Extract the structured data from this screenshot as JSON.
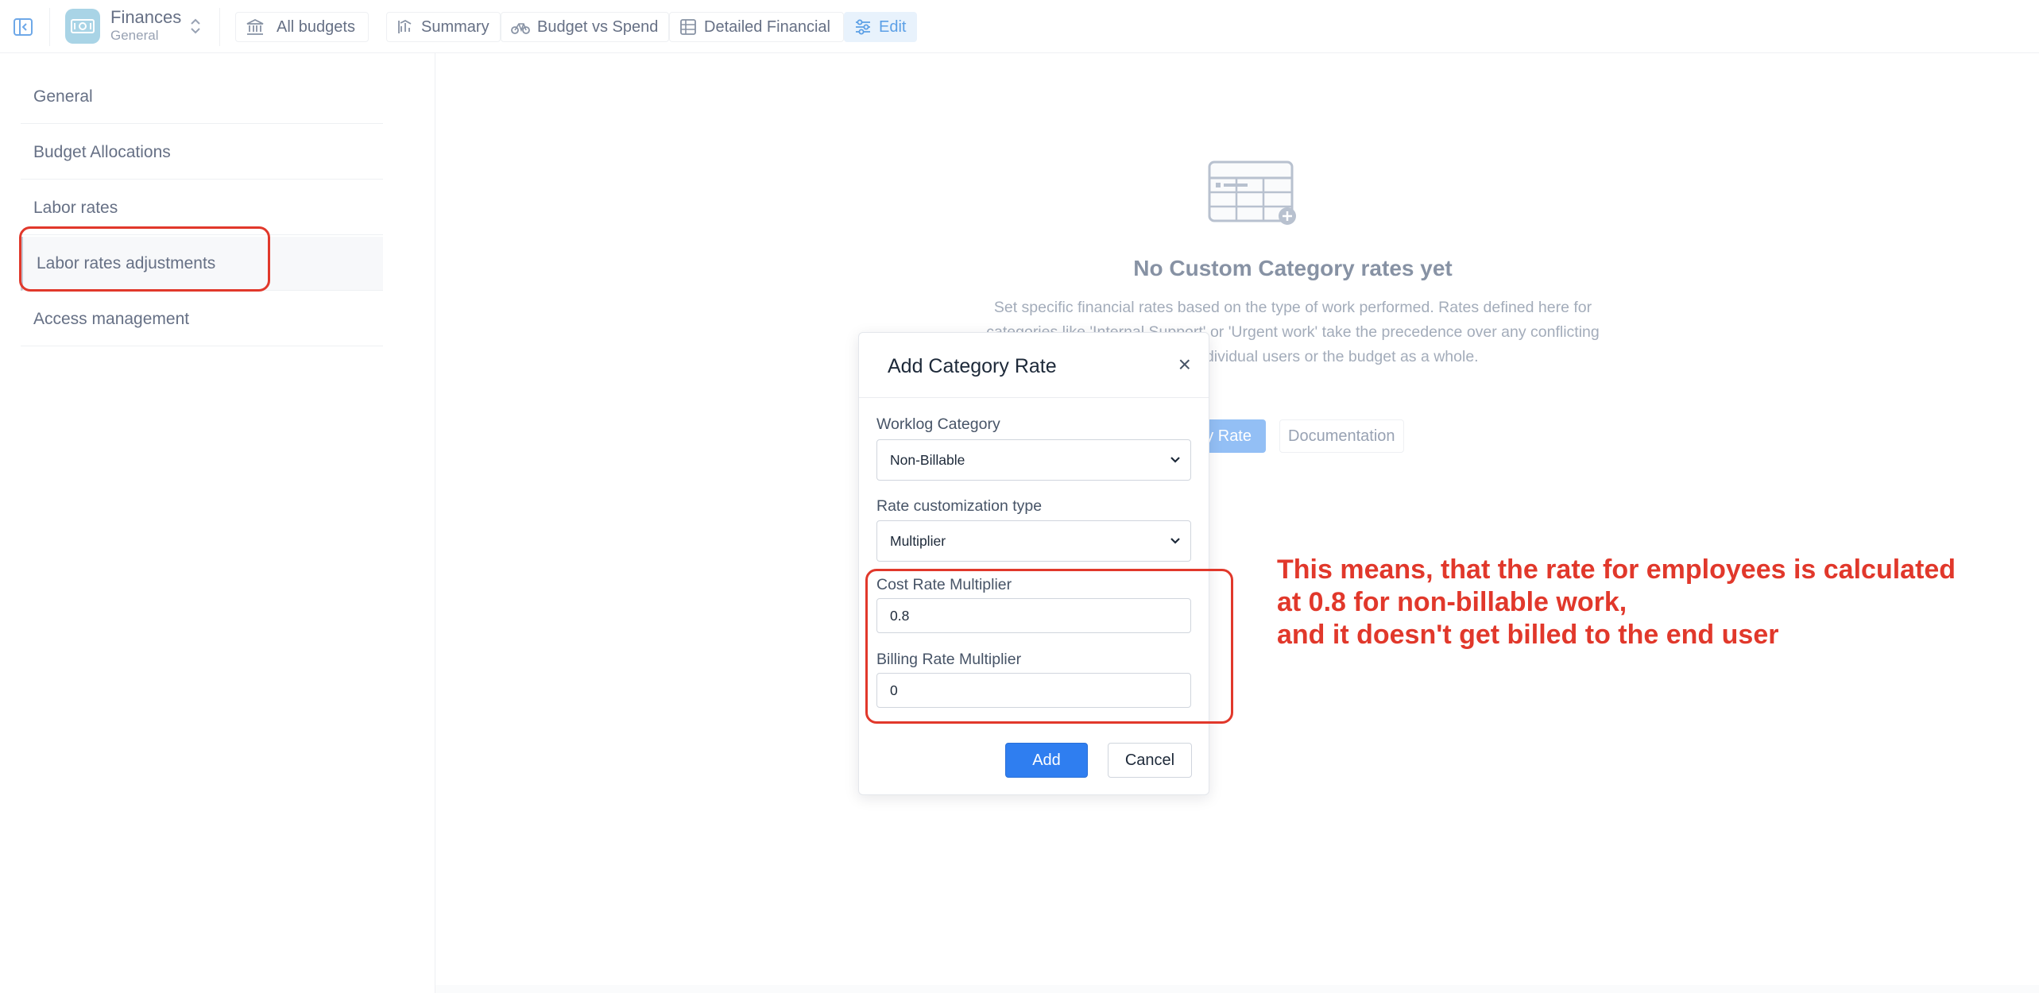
{
  "app": {
    "name": "Finances",
    "subtitle": "General"
  },
  "topnav": [
    {
      "label": "All budgets",
      "icon": "bank-icon"
    },
    {
      "label": "Summary",
      "icon": "chart-icon"
    },
    {
      "label": "Budget vs Spend",
      "icon": "bicycle-icon"
    },
    {
      "label": "Detailed Financial",
      "icon": "table-icon"
    },
    {
      "label": "Edit",
      "icon": "sliders-icon",
      "active": true
    }
  ],
  "sidebar": {
    "items": [
      {
        "label": "General"
      },
      {
        "label": "Budget Allocations"
      },
      {
        "label": "Labor rates"
      },
      {
        "label": "Labor rates adjustments",
        "selected": true
      },
      {
        "label": "Access management"
      }
    ]
  },
  "empty_state": {
    "title": "No Custom Category rates yet",
    "description": "Set specific financial rates based on the type of work performed. Rates defined here for categories like 'Internal Support' or 'Urgent work' take the precedence over any conflicting rates set for individual users or the budget as a whole.",
    "primary_button": "Add Category Rate",
    "primary_button_visible": "y Rate",
    "doc_button": "Documentation"
  },
  "modal": {
    "title": "Add Category Rate",
    "close_symbol": "×",
    "worklog_category": {
      "label": "Worklog Category",
      "value": "Non-Billable"
    },
    "rate_type": {
      "label": "Rate customization type",
      "value": "Multiplier"
    },
    "cost_rate": {
      "label": "Cost Rate Multiplier",
      "value": "0.8"
    },
    "billing_rate": {
      "label": "Billing Rate Multiplier",
      "value": "0"
    },
    "add_button": "Add",
    "cancel_button": "Cancel"
  },
  "annotation": {
    "lines": [
      "This means, that the rate for employees is calculated",
      "at 0.8 for non-billable work,",
      "and it doesn't get billed to the end user"
    ],
    "color": "#e1382b"
  },
  "colors": {
    "accent": "#2f7ef0",
    "active_tab_bg": "#e8f2fc",
    "annotation_red": "#e1382b"
  }
}
